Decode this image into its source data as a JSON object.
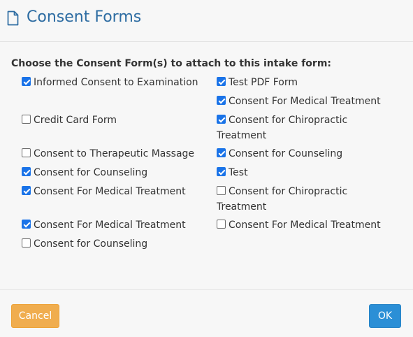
{
  "header": {
    "title": "Consent Forms",
    "icon": "document-icon"
  },
  "prompt": "Choose the Consent Form(s) to attach to this intake form:",
  "left_column": [
    {
      "label": "Informed Consent to Examination",
      "checked": true
    },
    {
      "label": "Credit Card Form",
      "checked": false
    },
    {
      "label": "Consent to Therapeutic Massage",
      "checked": false
    },
    {
      "label": "Consent for Counseling",
      "checked": true
    },
    {
      "label": "Consent For Medical Treatment",
      "checked": true
    },
    {
      "label": "Consent For Medical Treatment",
      "checked": true
    },
    {
      "label": "Consent for Counseling",
      "checked": false
    }
  ],
  "right_column": [
    {
      "label": "Test PDF Form",
      "checked": true
    },
    {
      "label": "Consent For Medical Treatment",
      "checked": true
    },
    {
      "label": "Consent for Chiropractic Treatment",
      "checked": true
    },
    {
      "label": "Consent for Counseling",
      "checked": true
    },
    {
      "label": "Test",
      "checked": true
    },
    {
      "label": "Consent for Chiropractic Treatment",
      "checked": false
    },
    {
      "label": "Consent For Medical Treatment",
      "checked": false
    }
  ],
  "footer": {
    "cancel_label": "Cancel",
    "ok_label": "OK"
  },
  "colors": {
    "title": "#2d6ca2",
    "checkbox_checked": "#1a73e8",
    "cancel_button": "#f0ad4e",
    "ok_button": "#2b8fd6"
  }
}
